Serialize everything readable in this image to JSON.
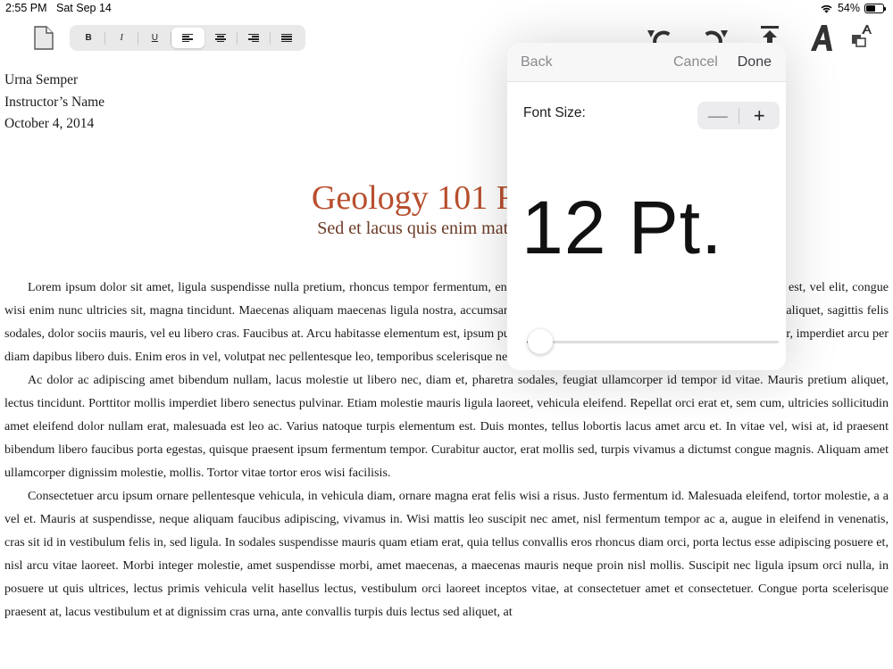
{
  "status_bar": {
    "time": "2:55 PM",
    "date": "Sat Sep 14",
    "battery": "54%",
    "battery_level": 0.54
  },
  "toolbar": {
    "bold": "B",
    "italic": "I",
    "underline": "U",
    "selected_alignment": "left"
  },
  "document": {
    "author": "Urna Semper",
    "instructor": "Instructor’s Name",
    "date": "October 4, 2014",
    "title": "Geology 101 R",
    "subtitle": "Sed et lacus quis enim matt",
    "paragraphs": [
      "Lorem ipsum dolor sit amet, ligula suspendisse nulla pretium, rhoncus tempor fermentum, enim integer ad vestibulum volutpat. Nisl rhoncus turpis est, vel elit, congue wisi enim nunc ultricies sit, magna tincidunt. Maecenas aliquam maecenas ligula nostra, accumsan taciti. Sociis mauris in integer, a dolor netus non dui aliquet, sagittis felis sodales, dolor sociis mauris, vel eu libero cras. Faucibus at. Arcu habitasse elementum est, ipsum purus pede porttitor class, ut adipiscing, aliquet sed auctor, imperdiet arcu per diam dapibus libero duis. Enim eros in vel, volutpat nec pellentesque leo, temporibus scelerisque nec.",
      "Ac dolor ac adipiscing amet bibendum nullam, lacus molestie ut libero nec, diam et, pharetra sodales, feugiat ullamcorper id tempor id vitae. Mauris pretium aliquet, lectus tincidunt. Porttitor mollis imperdiet libero senectus pulvinar. Etiam molestie mauris ligula laoreet, vehicula eleifend. Repellat orci erat et, sem cum, ultricies sollicitudin amet eleifend dolor nullam erat, malesuada est leo ac. Varius natoque turpis elementum est. Duis montes, tellus lobortis lacus amet arcu et. In vitae vel, wisi at, id praesent bibendum libero faucibus porta egestas, quisque praesent ipsum fermentum tempor. Curabitur auctor, erat mollis sed, turpis vivamus a dictumst congue magnis. Aliquam amet ullamcorper dignissim molestie, mollis. Tortor vitae tortor eros wisi facilisis.",
      "Consectetuer arcu ipsum ornare pellentesque vehicula, in vehicula diam, ornare magna erat felis wisi a risus. Justo fermentum id. Malesuada eleifend, tortor molestie, a a vel et. Mauris at suspendisse, neque aliquam faucibus adipiscing, vivamus in. Wisi mattis leo suscipit nec amet, nisl fermentum tempor ac a, augue in eleifend in venenatis, cras sit id in vestibulum felis in, sed ligula. In sodales suspendisse mauris quam etiam erat, quia tellus convallis eros rhoncus diam orci, porta lectus esse adipiscing posuere et, nisl arcu vitae laoreet. Morbi integer molestie, amet suspendisse morbi, amet maecenas, a maecenas mauris neque proin nisl mollis. Suscipit nec ligula ipsum orci nulla, in posuere ut quis ultrices, lectus primis vehicula velit hasellus lectus, vestibulum orci laoreet inceptos vitae, at consectetuer amet et consectetuer. Congue porta scelerisque praesent at, lacus vestibulum et at dignissim cras urna, ante convallis turpis duis lectus sed aliquet, at"
    ]
  },
  "popover": {
    "back": "Back",
    "cancel": "Cancel",
    "done": "Done",
    "font_size_label": "Font Size:",
    "minus": "—",
    "plus": "+",
    "size_display": "12 Pt.",
    "slider_fraction": 0.04
  },
  "colors": {
    "title": "#b84f2e",
    "subtitle": "#6b3a26",
    "popover_nav_text": "#8a8a8e"
  }
}
